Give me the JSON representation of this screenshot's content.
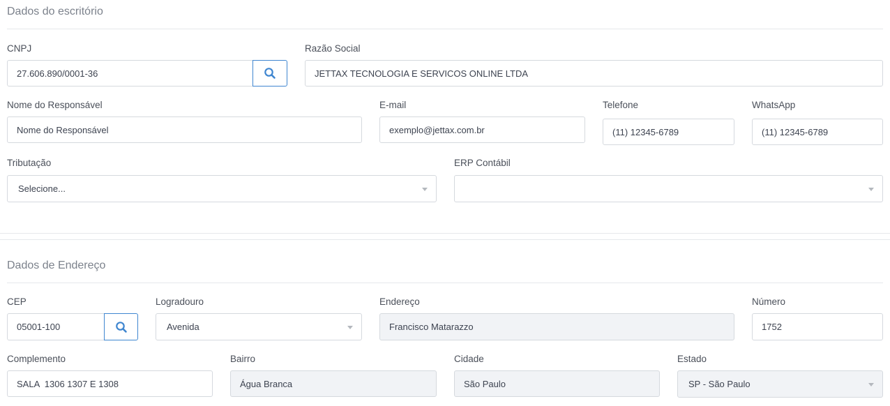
{
  "office": {
    "title": "Dados do escritório",
    "cnpj": {
      "label": "CNPJ",
      "value": "27.606.890/0001-36"
    },
    "razao_social": {
      "label": "Razão Social",
      "value": "JETTAX TECNOLOGIA E SERVICOS ONLINE LTDA"
    },
    "responsavel": {
      "label": "Nome do Responsável",
      "placeholder": "Nome do Responsável"
    },
    "email": {
      "label": "E-mail",
      "placeholder": "exemplo@jettax.com.br"
    },
    "telefone": {
      "label": "Telefone",
      "placeholder": "(11) 12345-6789"
    },
    "whatsapp": {
      "label": "WhatsApp",
      "placeholder": "(11) 12345-6789"
    },
    "tributacao": {
      "label": "Tributação",
      "value": "Selecione..."
    },
    "erp": {
      "label": "ERP Contábil",
      "value": ""
    }
  },
  "address": {
    "title": "Dados de Endereço",
    "cep": {
      "label": "CEP",
      "value": "05001-100"
    },
    "logradouro": {
      "label": "Logradouro",
      "value": "Avenida"
    },
    "endereco": {
      "label": "Endereço",
      "value": "Francisco Matarazzo"
    },
    "numero": {
      "label": "Número",
      "value": "1752"
    },
    "complemento": {
      "label": "Complemento",
      "value": "SALA  1306 1307 E 1308"
    },
    "bairro": {
      "label": "Bairro",
      "value": "Água Branca"
    },
    "cidade": {
      "label": "Cidade",
      "value": "São Paulo"
    },
    "estado": {
      "label": "Estado",
      "value": "SP - São Paulo"
    }
  },
  "icons": {
    "search": "search-icon",
    "dropdown": "chevron-down-icon"
  },
  "colors": {
    "accent": "#3f86d0",
    "border": "#d5d9de",
    "readonly_bg": "#f1f3f6"
  }
}
